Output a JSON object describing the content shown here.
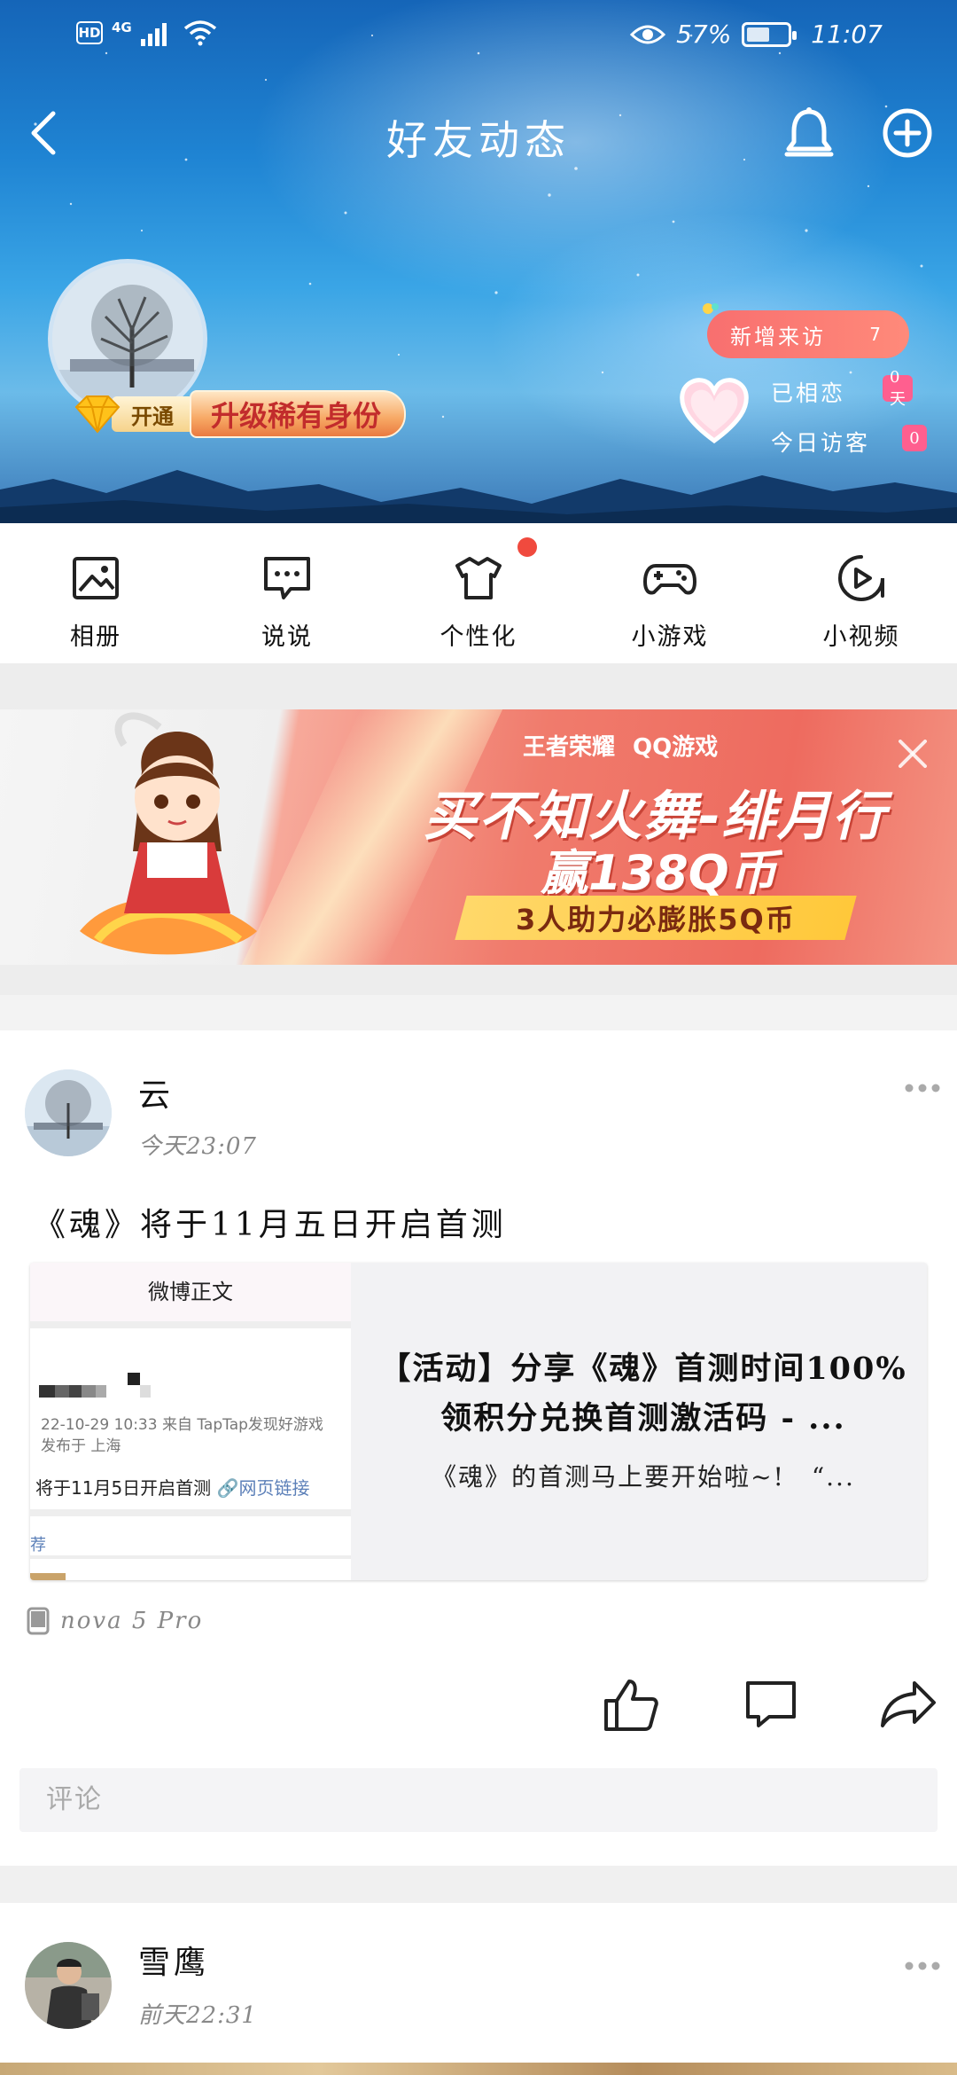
{
  "status_bar": {
    "hd": "HD",
    "network": "4G",
    "battery": "57%",
    "battery_level": 0.57,
    "time": "11:07"
  },
  "nav": {
    "title": "好友动态"
  },
  "profile": {
    "vip_open": "开通",
    "vip_upgrade": "升级稀有身份",
    "new_visits_label": "新增来访",
    "new_visits_count": "7",
    "love_label": "已相恋",
    "love_days": "0天",
    "today_visitors_label": "今日访客",
    "today_visitors_count": "0"
  },
  "quick_nav": [
    {
      "label": "相册",
      "icon": "photo-album-icon"
    },
    {
      "label": "说说",
      "icon": "message-icon"
    },
    {
      "label": "个性化",
      "icon": "tshirt-icon"
    },
    {
      "label": "小游戏",
      "icon": "gamepad-icon"
    },
    {
      "label": "小视频",
      "icon": "video-play-icon"
    }
  ],
  "banner": {
    "sponsor_1": "王者荣耀",
    "sponsor_2": "QQ游戏",
    "line1": "买不知火舞-绯月行",
    "line2": "赢138Q币",
    "line3": "3人助力必膨胀5Q币"
  },
  "post1": {
    "author": "云",
    "time": "今天23:07",
    "text": "《魂》将于11月五日开启首测",
    "card": {
      "thumb_header": "微博正文",
      "thumb_meta_1": "22-10-29 10:33  来自 TapTap发现好游戏",
      "thumb_meta_2": "发布于 上海",
      "thumb_lead": "将于11月5日开启首测",
      "thumb_link": "网页链接",
      "thumb_rec": "荐",
      "title": "【活动】分享《魂》首测时间100%领积分兑换首测激活码 - ...",
      "desc": "《魂》的首测马上要开始啦~!　“..."
    },
    "device": "nova 5 Pro",
    "comment_placeholder": "评论"
  },
  "post2": {
    "author": "雪鹰",
    "time": "前天22:31"
  },
  "colors": {
    "accent_red": "#f04a3e",
    "visits_pill": "#f86f6f",
    "love_badge": "#ff5f8f",
    "link_blue": "#5b7fb8"
  }
}
